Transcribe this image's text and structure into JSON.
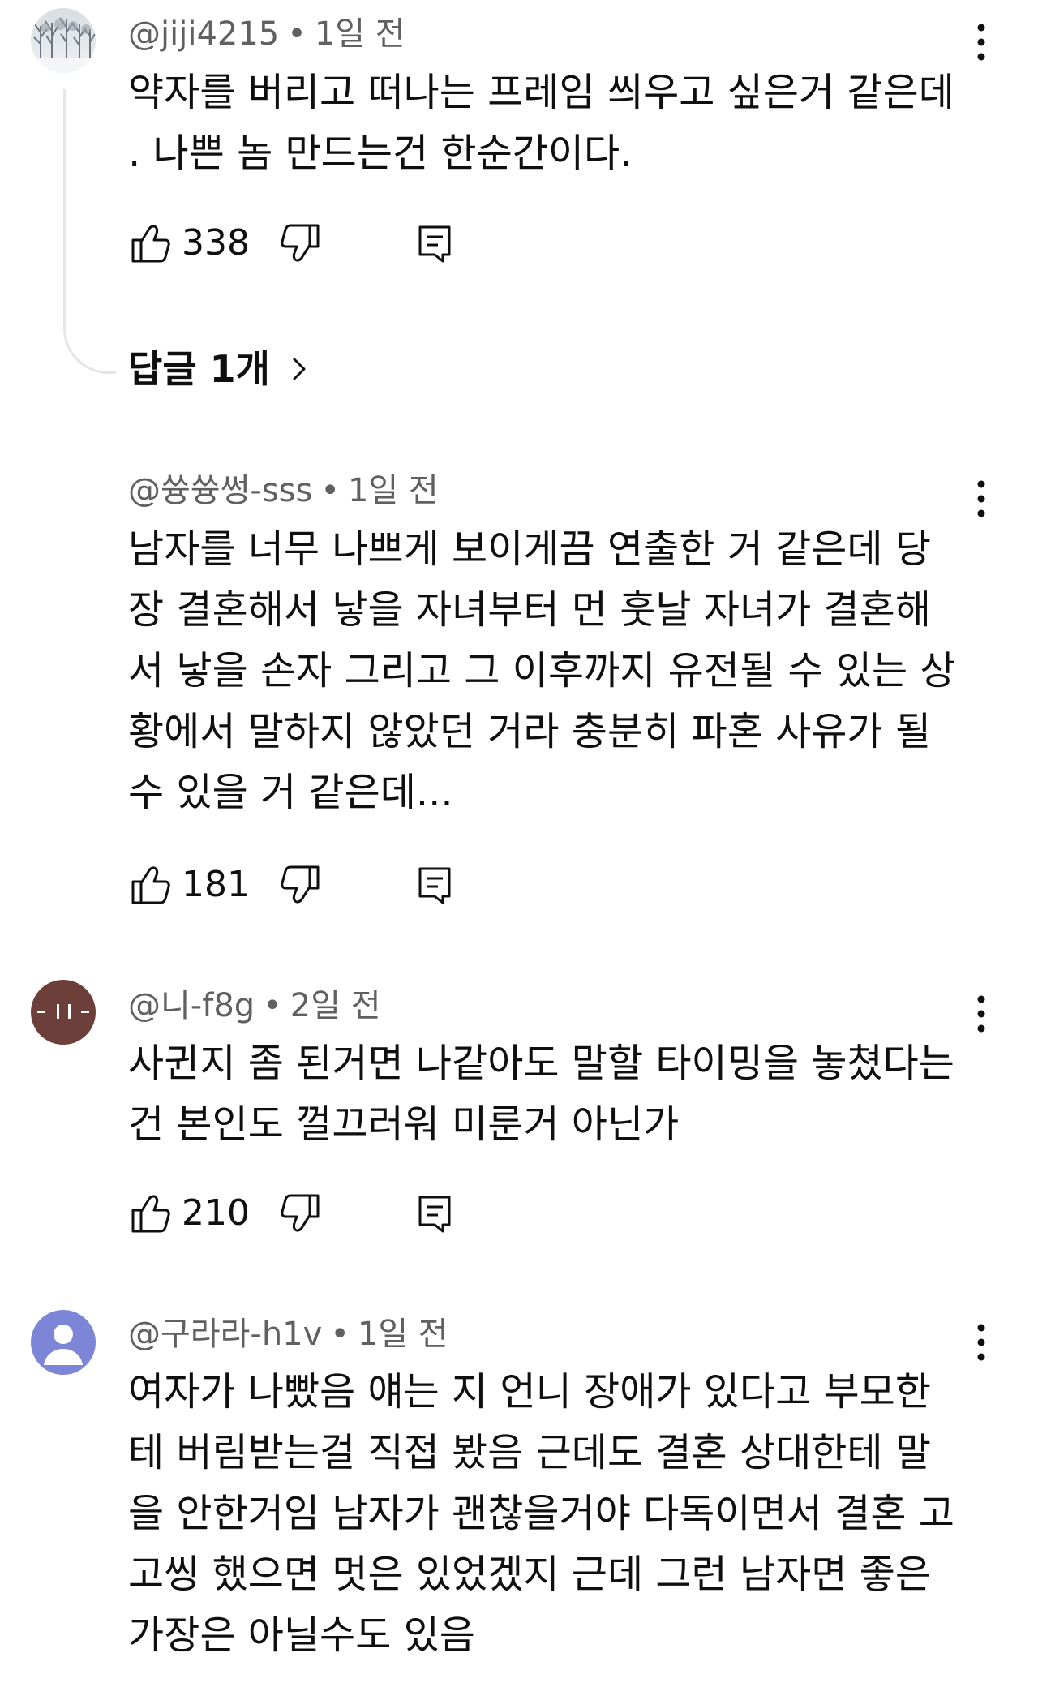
{
  "comments": [
    {
      "handle": "@jiji4215",
      "separator": "•",
      "time": "1일 전",
      "lines": [
        "약자를 버리고 떠나는 프레임 씌우고 싶은거 같은데",
        ". 나쁜 놈 만드는건 한순간이다."
      ],
      "likes": "338",
      "avatar_icon": "snowy-forest-avatar",
      "replies_label": "답글 1개"
    },
    {
      "handle": "@쓩쓩썽-sss",
      "separator": "•",
      "time": "1일 전",
      "lines": [
        "남자를 너무 나쁘게 보이게끔 연출한 거 같은데 당",
        "장 결혼해서 낳을 자녀부터 먼 훗날 자녀가 결혼해",
        "서 낳을 손자 그리고 그 이후까지 유전될 수 있는 상",
        "황에서 말하지 않았던 거라 충분히 파혼 사유가 될",
        "수 있을 거 같은데..."
      ],
      "likes": "181"
    },
    {
      "handle": "@니-f8g",
      "separator": "•",
      "time": "2일 전",
      "lines": [
        "사귄지 좀 된거면 나같아도 말할 타이밍을 놓쳤다는",
        "건 본인도 껄끄러워 미룬거 아닌가"
      ],
      "likes": "210",
      "avatar_color": "#6d3f3a",
      "avatar_icon": "brown-avatar"
    },
    {
      "handle": "@구라라-h1v",
      "separator": "•",
      "time": "1일 전",
      "lines": [
        "여자가 나빴음 얘는 지 언니 장애가 있다고 부모한",
        "테 버림받는걸 직접 봤음 근데도 결혼 상대한테 말",
        "을 안한거임 남자가 괜찮을거야 다독이면서 결혼 고",
        "고씽 했으면 멋은 있었겠지 근데 그런 남자면 좋은",
        "가장은 아닐수도 있음"
      ],
      "avatar_color": "#7d86d6",
      "avatar_icon": "default-person-avatar"
    }
  ],
  "icons": {
    "like": "thumbs-up-icon",
    "dislike": "thumbs-down-icon",
    "reply": "reply-comment-icon",
    "more": "more-vertical-icon",
    "chevron": "chevron-right-icon"
  },
  "colors": {
    "text": "#0f0f0f",
    "meta": "#606060",
    "thread_line": "#e5e5e5"
  }
}
